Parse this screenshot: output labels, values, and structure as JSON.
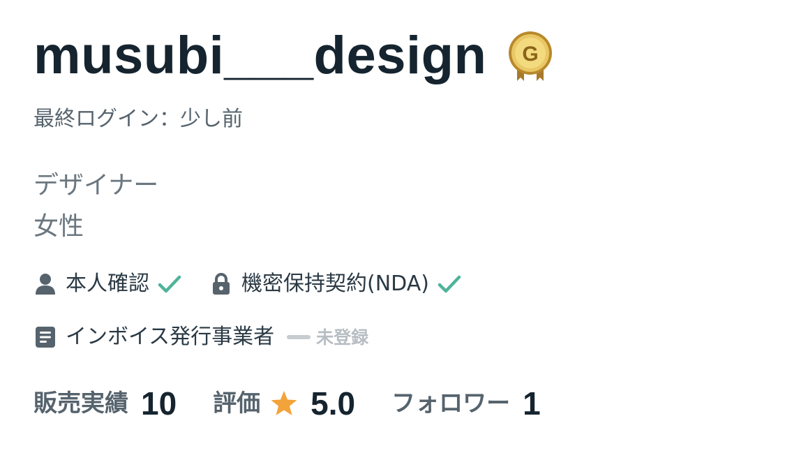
{
  "profile": {
    "username": "musubi___design",
    "rank_badge_letter": "G",
    "last_login": "最終ログイン：少し前",
    "job": "デザイナー",
    "gender": "女性"
  },
  "verifications": {
    "identity_label": "本人確認",
    "nda_label": "機密保持契約(NDA)",
    "invoice_label": "インボイス発行事業者",
    "invoice_status": "未登録"
  },
  "stats": {
    "sales_label": "販売実績",
    "sales_value": "10",
    "rating_label": "評価",
    "rating_value": "5.0",
    "followers_label": "フォロワー",
    "followers_value": "1"
  },
  "colors": {
    "check": "#4fb39a",
    "star": "#f2a33a",
    "badge_gold": "#c99a2e",
    "icon_gray": "#56636d"
  }
}
